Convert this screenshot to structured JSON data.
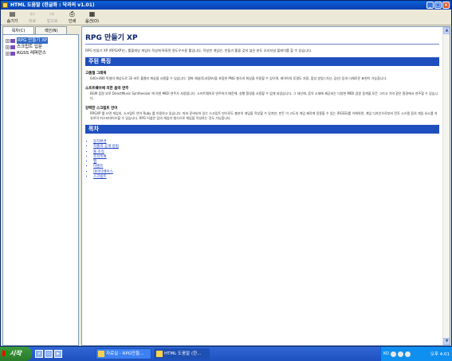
{
  "window": {
    "title": "HTML 도움말 (한글화 : 닥과의 v1.01)"
  },
  "toolbar": {
    "buttons": [
      {
        "label": "숨기기",
        "icon": "hide-icon",
        "enabled": true
      },
      {
        "label": "뒤로",
        "icon": "back-icon",
        "enabled": false
      },
      {
        "label": "앞으로",
        "icon": "forward-icon",
        "enabled": false
      },
      {
        "label": "인쇄",
        "icon": "print-icon",
        "enabled": true
      },
      {
        "label": "옵션(O)",
        "icon": "options-icon",
        "enabled": true
      }
    ]
  },
  "nav": {
    "tabs": [
      "목차(C)",
      "색인(N)"
    ],
    "tree": [
      {
        "label": "RPG 만들기 XP",
        "selected": true
      },
      {
        "label": "스크립트 입문",
        "selected": false
      },
      {
        "label": "RGSS 레퍼런스",
        "selected": false
      }
    ]
  },
  "page": {
    "title": "RPG 만들기 XP",
    "intro": "RPG 만들기 XP (RPGXP)는, 롤플레잉 게임의 작성에 특화된 윈도우즈용 툴입니다. 작성한 게임은, 만들기 툴을 갖지 않은 분도 오리지널 플레이를 할 수 있습니다.",
    "features_heading": "주된 특징",
    "features": [
      {
        "title": "고품질 그래픽",
        "body": "640×480 픽셀의 해상도로 32 비트 풀컬러 화상을 사용할 수 있습니다. 알파 채널(투과정보)을 포함한 PNG 형식의 화상을 이용할 수 있으며, 레이어의 투명도 지정, 합성 방법 (가산, 감산) 등의 다채로운 표현이 가능합니다."
      },
      {
        "title": "소프트웨어에 의한 음악 연주",
        "body": "BGM 음원 부로 DirectMusic Synthesizer 에 의한 MIDI 연주가 사용됩니다. 소프트웨어로 연주하기 때문에, 실행 환경을 사용할 수 없게 되었습니다. 그 대신에, 음악 소재에 제공되는 다양한 MIDI 음원 음색을 모든 그리고 거의 같은 환경에서 연주할 수 있습니다."
      },
      {
        "title": "강력한 스크립트 언어",
        "body": "RPGXP 를 쓰면 게임의, 스크립트 언어 Ruby 를 이용하고 있습니다. 따라 준비되어 있는 스크립트 만으로도 충분히 게임을 작성할 수 있지만, 만든 이 고도의 게임 제작에 응용할 수 있는 (RGSS)를 이해하면, 게임 디자인으로부터 전투 시스템 등의 게임 요소를 자유로이 커스터마이즈할 수 있습니다. RPG 어셈은 임의 게임의 형식으로 게임을 작성하는 것도 가능합니다."
      }
    ],
    "toc_heading": "목차",
    "toc": [
      "동작환경",
      "작품의 공개 방법",
      "툴 조작",
      "조작목록",
      "맵",
      "이벤트",
      "데이터베이스",
      "스크립트"
    ]
  },
  "taskbar": {
    "start_label": "시작",
    "tasks": [
      {
        "label": "자료실 - RPG만들...",
        "active": false
      },
      {
        "label": "HTML 도움말 (한...",
        "active": true
      }
    ],
    "lang": "KO",
    "clock": "오후 4:01"
  }
}
